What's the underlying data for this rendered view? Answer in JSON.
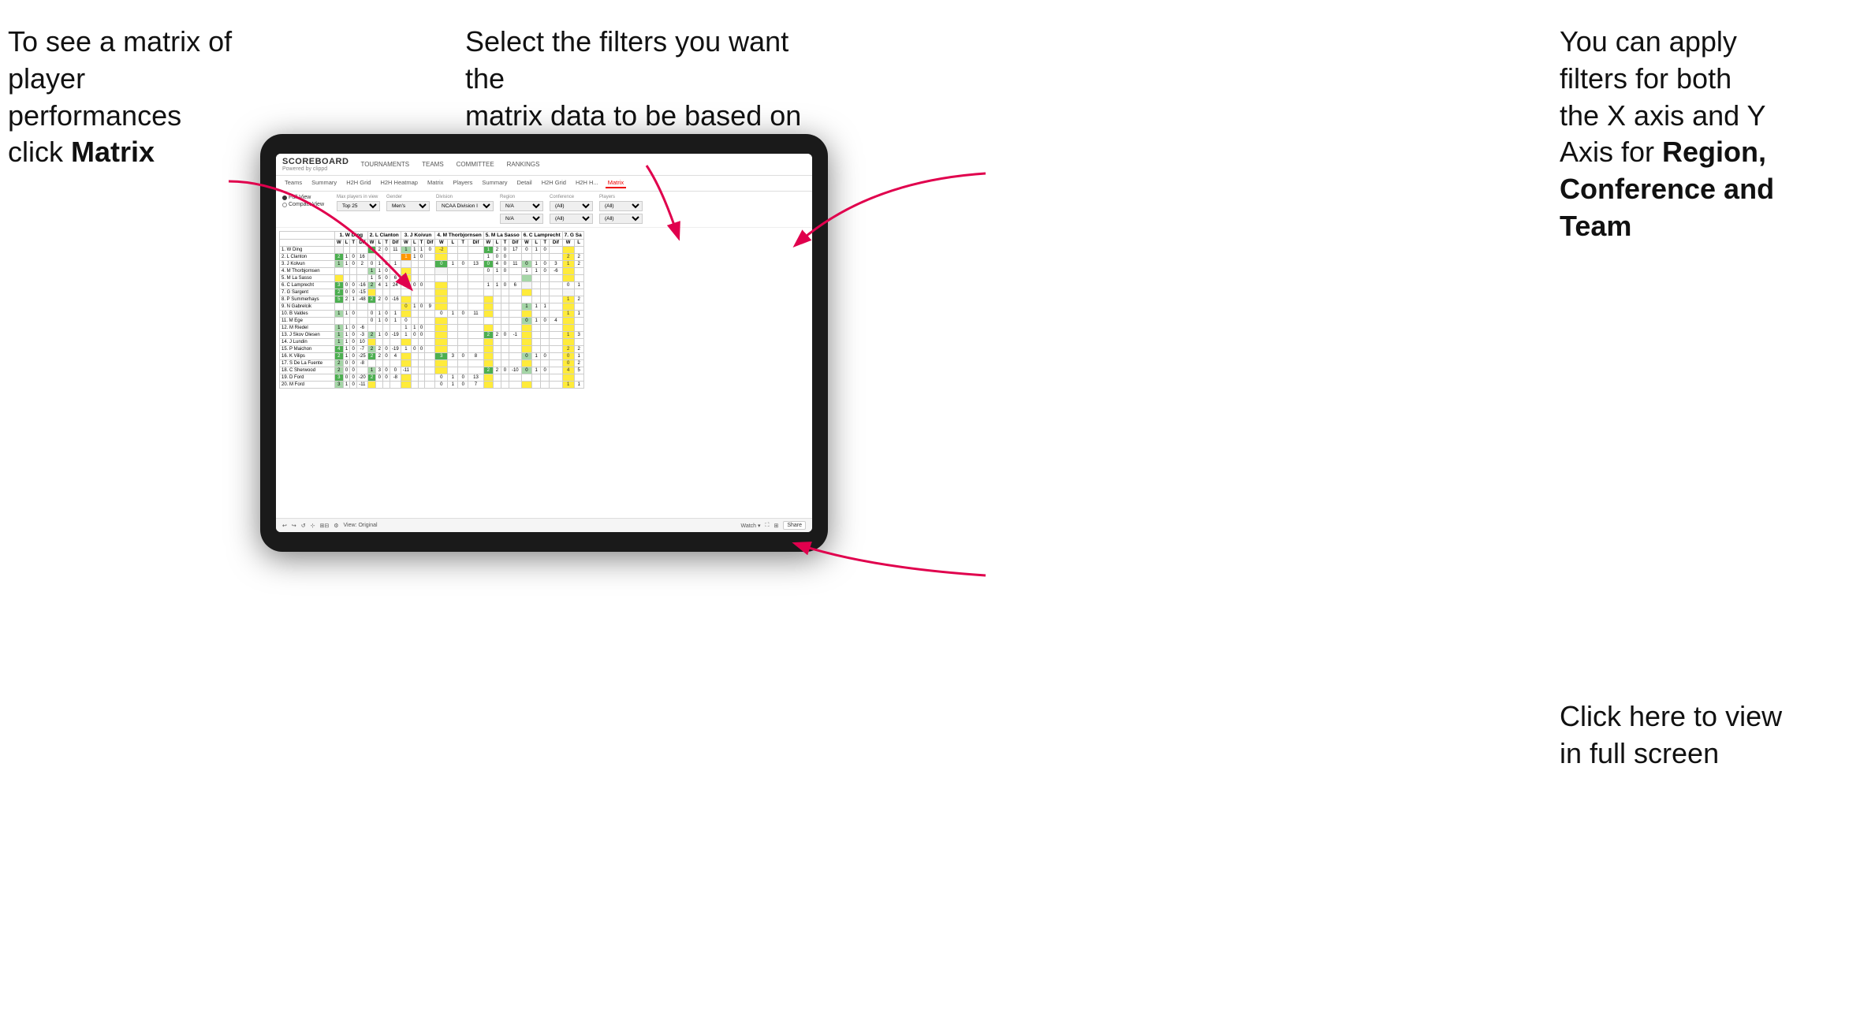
{
  "annotations": {
    "topleft_line1": "To see a matrix of",
    "topleft_line2": "player performances",
    "topleft_line3": "click ",
    "topleft_bold": "Matrix",
    "topmid_line1": "Select the filters you want the",
    "topmid_line2": "matrix data to be based on",
    "topright_line1": "You  can apply",
    "topright_line2": "filters for both",
    "topright_line3": "the X axis and Y",
    "topright_line4": "Axis for ",
    "topright_bold1": "Region,",
    "topright_line5": "",
    "topright_bold2": "Conference and",
    "topright_line6": "",
    "topright_bold3": "Team",
    "bottomright_line1": "Click here to view",
    "bottomright_line2": "in full screen"
  },
  "app": {
    "logo": "SCOREBOARD",
    "logo_sub": "Powered by clippd",
    "nav": [
      "TOURNAMENTS",
      "TEAMS",
      "COMMITTEE",
      "RANKINGS"
    ],
    "subtabs": [
      "Teams",
      "Summary",
      "H2H Grid",
      "H2H Heatmap",
      "Matrix",
      "Players",
      "Summary",
      "Detail",
      "H2H Grid",
      "H2H H...",
      "Matrix"
    ],
    "active_subtab": "Matrix",
    "filters": {
      "view_options": [
        "Full View",
        "Compact View"
      ],
      "active_view": "Full View",
      "max_players_label": "Max players in view",
      "max_players_value": "Top 25",
      "gender_label": "Gender",
      "gender_value": "Men's",
      "division_label": "Division",
      "division_value": "NCAA Division I",
      "region_label": "Region",
      "region_value": "N/A",
      "conference_label": "Conference",
      "conference_value": "(All)",
      "players_label": "Players",
      "players_value": "(All)"
    },
    "matrix_headers": [
      "1. W Ding",
      "2. L Clanton",
      "3. J Koivun",
      "4. M Thorbjornsen",
      "5. M La Sasso",
      "6. C Lamprecht",
      "7. G Sa"
    ],
    "sub_headers": [
      "W",
      "L",
      "T",
      "Dif"
    ],
    "players": [
      "1. W Ding",
      "2. L Clanton",
      "3. J Kolvun",
      "4. M Thorbjornsen",
      "5. M La Sasso",
      "6. C Lamprecht",
      "7. G Sargent",
      "8. P Summerhays",
      "9. N Gabrelcik",
      "10. B Valdes",
      "11. M Ege",
      "12. M Riedel",
      "13. J Skov Olesen",
      "14. J Lundin",
      "15. P Maichon",
      "16. K Vilips",
      "17. S De La Fuente",
      "18. C Sherwood",
      "19. D Ford",
      "20. M Ford"
    ],
    "toolbar": {
      "view_label": "View: Original",
      "watch_label": "Watch ▾",
      "share_label": "Share"
    }
  }
}
